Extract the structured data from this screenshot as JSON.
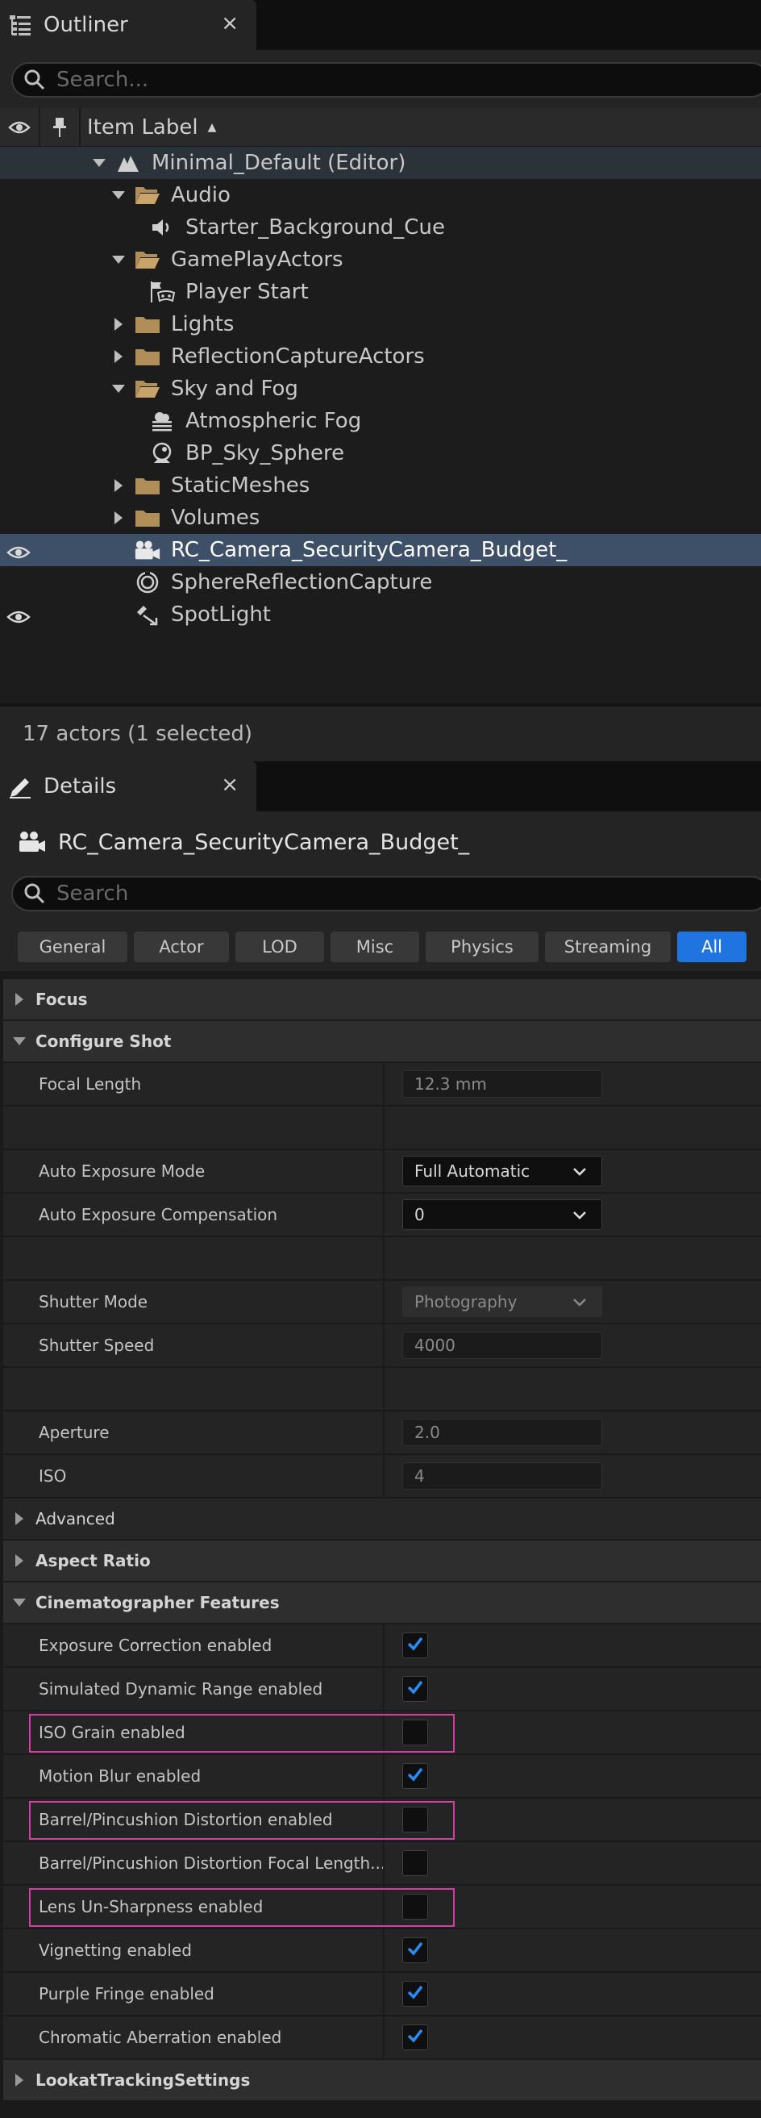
{
  "outliner": {
    "tab_title": "Outliner",
    "close_glyph": "×",
    "search_placeholder": "Search...",
    "column_label": "Item Label",
    "items": [
      {
        "label": "Minimal_Default (Editor)",
        "indent": 0,
        "arrow": "down",
        "icon": "level-icon",
        "state": "highlight"
      },
      {
        "label": "Audio",
        "indent": 1,
        "arrow": "down",
        "icon": "folder-open-icon"
      },
      {
        "label": "Starter_Background_Cue",
        "indent": 2,
        "arrow": "none",
        "icon": "speaker-icon"
      },
      {
        "label": "GamePlayActors",
        "indent": 1,
        "arrow": "down",
        "icon": "folder-open-icon"
      },
      {
        "label": "Player Start",
        "indent": 2,
        "arrow": "none",
        "icon": "player-start-icon"
      },
      {
        "label": "Lights",
        "indent": 1,
        "arrow": "right",
        "icon": "folder-icon"
      },
      {
        "label": "ReflectionCaptureActors",
        "indent": 1,
        "arrow": "right",
        "icon": "folder-icon"
      },
      {
        "label": "Sky and Fog",
        "indent": 1,
        "arrow": "down",
        "icon": "folder-open-icon"
      },
      {
        "label": "Atmospheric Fog",
        "indent": 2,
        "arrow": "none",
        "icon": "fog-icon"
      },
      {
        "label": "BP_Sky_Sphere",
        "indent": 2,
        "arrow": "none",
        "icon": "sky-sphere-icon"
      },
      {
        "label": "StaticMeshes",
        "indent": 1,
        "arrow": "right",
        "icon": "folder-icon"
      },
      {
        "label": "Volumes",
        "indent": 1,
        "arrow": "right",
        "icon": "folder-icon"
      },
      {
        "label": "RC_Camera_SecurityCamera_Budget_",
        "indent": 1,
        "arrow": "none",
        "icon": "camera-icon",
        "state": "selected",
        "eye": true
      },
      {
        "label": "SphereReflectionCapture",
        "indent": 1,
        "arrow": "none",
        "icon": "reflection-capture-icon"
      },
      {
        "label": "SpotLight",
        "indent": 1,
        "arrow": "none",
        "icon": "spotlight-icon",
        "eye": true
      }
    ],
    "footer": "17 actors (1 selected)"
  },
  "details": {
    "tab_title": "Details",
    "close_glyph": "×",
    "actor_name": "RC_Camera_SecurityCamera_Budget_",
    "search_placeholder": "Search",
    "filters": [
      {
        "label": "General",
        "active": false
      },
      {
        "label": "Actor",
        "active": false
      },
      {
        "label": "LOD",
        "active": false
      },
      {
        "label": "Misc",
        "active": false
      },
      {
        "label": "Physics",
        "active": false
      },
      {
        "label": "Streaming",
        "active": false
      },
      {
        "label": "All",
        "active": true
      }
    ],
    "rows": [
      {
        "kind": "cat",
        "label": "Focus",
        "expanded": false
      },
      {
        "kind": "cat",
        "label": "Configure Shot",
        "expanded": true
      },
      {
        "kind": "prop",
        "label": "Focal Length",
        "control": "number",
        "value": "12.3 mm"
      },
      {
        "kind": "spacer"
      },
      {
        "kind": "prop",
        "label": "Auto Exposure Mode",
        "control": "combo",
        "value": "Full Automatic"
      },
      {
        "kind": "prop",
        "label": "Auto Exposure Compensation",
        "control": "combo",
        "value": "0"
      },
      {
        "kind": "spacer"
      },
      {
        "kind": "prop",
        "label": "Shutter Mode",
        "control": "combo-disabled",
        "value": "Photography"
      },
      {
        "kind": "prop",
        "label": "Shutter Speed",
        "control": "number",
        "value": "4000"
      },
      {
        "kind": "spacer"
      },
      {
        "kind": "prop",
        "label": "Aperture",
        "control": "number",
        "value": "2.0"
      },
      {
        "kind": "prop",
        "label": "ISO",
        "control": "number",
        "value": "4"
      },
      {
        "kind": "subcat",
        "label": "Advanced",
        "expanded": false
      },
      {
        "kind": "cat",
        "label": "Aspect Ratio",
        "expanded": false
      },
      {
        "kind": "cat",
        "label": "Cinematographer Features",
        "expanded": true
      },
      {
        "kind": "prop",
        "label": "Exposure Correction enabled",
        "control": "check",
        "checked": true
      },
      {
        "kind": "prop",
        "label": "Simulated Dynamic Range enabled",
        "control": "check",
        "checked": true
      },
      {
        "kind": "prop",
        "label": "ISO Grain enabled",
        "control": "check",
        "checked": false,
        "highlight": true
      },
      {
        "kind": "prop",
        "label": "Motion Blur enabled",
        "control": "check",
        "checked": true
      },
      {
        "kind": "prop",
        "label": "Barrel/Pincushion Distortion enabled",
        "control": "check",
        "checked": false,
        "highlight": true
      },
      {
        "kind": "prop",
        "label": "Barrel/Pincushion Distortion Focal Length...",
        "control": "check",
        "checked": false
      },
      {
        "kind": "prop",
        "label": "Lens Un-Sharpness enabled",
        "control": "check",
        "checked": false,
        "highlight": true
      },
      {
        "kind": "prop",
        "label": "Vignetting enabled",
        "control": "check",
        "checked": true
      },
      {
        "kind": "prop",
        "label": "Purple Fringe enabled",
        "control": "check",
        "checked": true
      },
      {
        "kind": "prop",
        "label": "Chromatic Aberration enabled",
        "control": "check",
        "checked": true
      },
      {
        "kind": "cat",
        "label": "LookatTrackingSettings",
        "expanded": false
      }
    ]
  },
  "colors": {
    "accent": "#1f74e0",
    "check": "#2a8cf2",
    "highlight_border": "#d23ea4",
    "selected_row": "#3d5067",
    "folder": "#b08e5a"
  }
}
